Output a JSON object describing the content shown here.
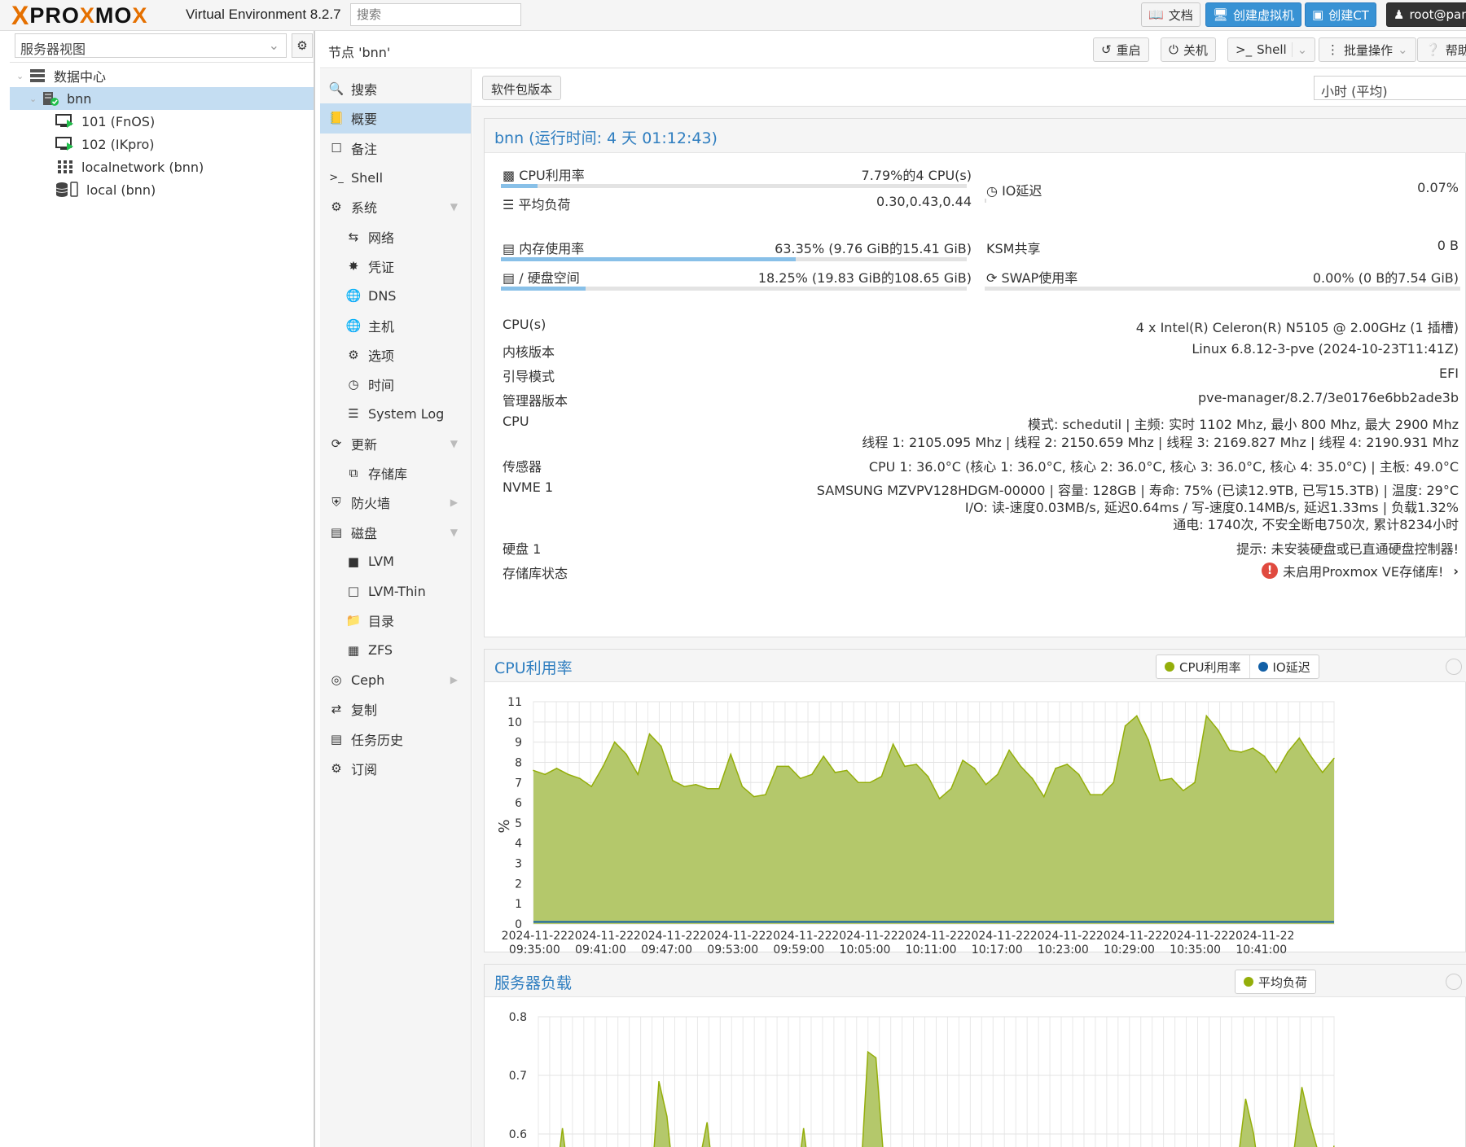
{
  "topbar": {
    "logo_x": "X",
    "logo_text_a": "PRO",
    "logo_text_x": "X",
    "logo_text_b": "MO",
    "logo_text_x2": "X",
    "version": "Virtual Environment 8.2.7",
    "search_placeholder": "搜索",
    "docs": "文档",
    "create_vm": "创建虚拟机",
    "create_ct": "创建CT",
    "user": "root@pam"
  },
  "sidebar": {
    "view_select": "服务器视图",
    "tree": [
      {
        "label": "数据中心"
      },
      {
        "label": "bnn"
      },
      {
        "label": "101 (FnOS)"
      },
      {
        "label": "102 (IKpro)"
      },
      {
        "label": "localnetwork (bnn)"
      },
      {
        "label": "local (bnn)"
      }
    ]
  },
  "header": {
    "title": "节点 'bnn'",
    "reboot": "重启",
    "shutdown": "关机",
    "shell": "Shell",
    "bulk": "批量操作",
    "help": "帮助"
  },
  "nav": {
    "items": [
      {
        "label": "搜索"
      },
      {
        "label": "概要"
      },
      {
        "label": "备注"
      },
      {
        "label": "Shell"
      },
      {
        "label": "系统"
      },
      {
        "label": "网络"
      },
      {
        "label": "凭证"
      },
      {
        "label": "DNS"
      },
      {
        "label": "主机"
      },
      {
        "label": "选项"
      },
      {
        "label": "时间"
      },
      {
        "label": "System Log"
      },
      {
        "label": "更新"
      },
      {
        "label": "存储库"
      },
      {
        "label": "防火墙"
      },
      {
        "label": "磁盘"
      },
      {
        "label": "LVM"
      },
      {
        "label": "LVM-Thin"
      },
      {
        "label": "目录"
      },
      {
        "label": "ZFS"
      },
      {
        "label": "Ceph"
      },
      {
        "label": "复制"
      },
      {
        "label": "任务历史"
      },
      {
        "label": "订阅"
      }
    ]
  },
  "toolbar": {
    "pkg_versions": "软件包版本",
    "timeframe": "小时 (平均)"
  },
  "status": {
    "title": "bnn (运行时间: 4 天 01:12:43)",
    "cpu_label": "CPU利用率",
    "cpu_value": "7.79%的4 CPU(s)",
    "cpu_fraction": 0.0779,
    "io_label": "IO延迟",
    "io_value": "0.07%",
    "load_label": "平均负荷",
    "load_value": "0.30,0.43,0.44",
    "mem_label": "内存使用率",
    "mem_value": "63.35% (9.76 GiB的15.41 GiB)",
    "mem_fraction": 0.6335,
    "ksm_label": "KSM共享",
    "ksm_value": "0 B",
    "disk_label": "/ 硬盘空间",
    "disk_value": "18.25% (19.83 GiB的108.65 GiB)",
    "disk_fraction": 0.1825,
    "swap_label": "SWAP使用率",
    "swap_value": "0.00% (0 B的7.54 GiB)",
    "swap_fraction": 0.0
  },
  "info": {
    "cpus_label": "CPU(s)",
    "cpus_value": "4 x Intel(R) Celeron(R) N5105 @ 2.00GHz (1 插槽)",
    "kernel_label": "内核版本",
    "kernel_value": "Linux 6.8.12-3-pve (2024-10-23T11:41Z)",
    "boot_label": "引导模式",
    "boot_value": "EFI",
    "manager_label": "管理器版本",
    "manager_value": "pve-manager/8.2.7/3e0176e6bb2ade3b",
    "cpu_label": "CPU",
    "cpu_line1": "模式: schedutil | 主频: 实时 1102 Mhz, 最小 800 Mhz, 最大 2900 Mhz",
    "cpu_line2": "线程 1: 2105.095 Mhz | 线程 2: 2150.659 Mhz | 线程 3: 2169.827 Mhz | 线程 4: 2190.931 Mhz",
    "sensor_label": "传感器",
    "sensor_value": "CPU 1: 36.0°C (核心 1: 36.0°C, 核心 2: 36.0°C, 核心 3: 36.0°C, 核心 4: 35.0°C) | 主板: 49.0°C",
    "nvme_label": "NVME 1",
    "nvme_line1": "SAMSUNG MZVPV128HDGM-00000 | 容量: 128GB | 寿命: 75% (已读12.9TB, 已写15.3TB) | 温度: 29°C",
    "nvme_line2": "I/O: 读-速度0.03MB/s, 延迟0.64ms / 写-速度0.14MB/s, 延迟1.33ms | 负载1.32%",
    "nvme_line3": "通电: 1740次, 不安全断电750次, 累计8234小时",
    "hdd_label": "硬盘 1",
    "hdd_value": "提示: 未安装硬盘或已直通硬盘控制器!",
    "repo_label": "存储库状态",
    "repo_value": "未启用Proxmox VE存储库!"
  },
  "cpu_chart": {
    "title": "CPU利用率",
    "legend_cpu": "CPU利用率",
    "legend_io": "IO延迟",
    "ylabel": "%"
  },
  "load_chart": {
    "title": "服务器负载",
    "legend_load": "平均负荷"
  },
  "chart_data": [
    {
      "type": "area",
      "title": "CPU利用率",
      "ylabel": "%",
      "ylim": [
        0,
        11
      ],
      "yticks": [
        "0",
        "1",
        "2",
        "3",
        "4",
        "5",
        "6",
        "7",
        "8",
        "9",
        "10",
        "11"
      ],
      "xtick_dates": [
        "2024-11-22",
        "2024-11-22",
        "2024-11-22",
        "2024-11-22",
        "2024-11-22",
        "2024-11-22",
        "2024-11-22",
        "2024-11-22",
        "2024-11-22",
        "2024-11-22",
        "2024-11-22",
        "2024-11-22"
      ],
      "xtick_times": [
        "09:35:00",
        "09:41:00",
        "09:47:00",
        "09:53:00",
        "09:59:00",
        "10:05:00",
        "10:11:00",
        "10:17:00",
        "10:23:00",
        "10:29:00",
        "10:35:00",
        "10:41:00"
      ],
      "x_start_min": -0.1,
      "x_end_min": 72.6,
      "series": [
        {
          "name": "CPU利用率",
          "color": "#94ae0a",
          "values": [
            7.6,
            7.4,
            7.7,
            7.4,
            7.2,
            6.8,
            7.8,
            9.0,
            8.4,
            7.4,
            9.4,
            8.8,
            7.1,
            6.8,
            6.9,
            6.7,
            6.7,
            8.4,
            6.8,
            6.3,
            6.4,
            7.8,
            7.8,
            7.2,
            7.4,
            8.3,
            7.5,
            7.6,
            7.0,
            7.0,
            7.3,
            8.9,
            7.8,
            7.9,
            7.3,
            6.2,
            6.7,
            8.1,
            7.7,
            6.9,
            7.4,
            8.6,
            7.8,
            7.2,
            6.3,
            7.7,
            7.9,
            7.4,
            6.4,
            6.4,
            7.0,
            9.8,
            10.3,
            9.1,
            7.1,
            7.2,
            6.6,
            7.0,
            10.3,
            9.6,
            8.6,
            8.5,
            8.7,
            8.3,
            7.5,
            8.5,
            9.2,
            8.3,
            7.5,
            8.2
          ]
        },
        {
          "name": "IO延迟",
          "color": "#115fa6",
          "values": [
            0.1,
            0.1,
            0.1,
            0.1,
            0.1,
            0.1,
            0.1,
            0.1,
            0.1,
            0.1,
            0.1,
            0.1,
            0.1,
            0.1,
            0.1,
            0.1,
            0.1,
            0.1,
            0.1,
            0.1,
            0.1,
            0.1,
            0.1,
            0.1,
            0.1,
            0.1,
            0.1,
            0.1,
            0.1,
            0.1,
            0.1,
            0.1,
            0.1,
            0.1,
            0.1,
            0.1,
            0.1,
            0.1,
            0.1,
            0.1,
            0.1,
            0.1,
            0.1,
            0.1,
            0.1,
            0.1,
            0.1,
            0.1,
            0.1,
            0.1,
            0.1,
            0.1,
            0.1,
            0.1,
            0.1,
            0.1,
            0.1,
            0.1,
            0.1,
            0.1,
            0.1,
            0.1,
            0.1,
            0.1,
            0.1,
            0.1,
            0.1,
            0.1,
            0.1,
            0.1
          ]
        }
      ]
    },
    {
      "type": "area",
      "title": "服务器负载",
      "ylim": [
        0.5,
        0.8
      ],
      "yticks": [
        "0.8",
        "0.7",
        "0.6"
      ],
      "series": [
        {
          "name": "平均负荷",
          "color": "#94ae0a",
          "values": [
            0.5,
            0.5,
            0.5,
            0.61,
            0.5,
            0.5,
            0.5,
            0.5,
            0.5,
            0.5,
            0.5,
            0.5,
            0.5,
            0.5,
            0.5,
            0.69,
            0.63,
            0.5,
            0.5,
            0.5,
            0.55,
            0.62,
            0.5,
            0.5,
            0.5,
            0.5,
            0.5,
            0.5,
            0.5,
            0.5,
            0.5,
            0.5,
            0.5,
            0.61,
            0.5,
            0.5,
            0.5,
            0.5,
            0.5,
            0.5,
            0.5,
            0.74,
            0.73,
            0.55,
            0.5,
            0.5,
            0.5,
            0.5,
            0.5,
            0.5,
            0.5,
            0.5,
            0.5,
            0.5,
            0.5,
            0.5,
            0.5,
            0.5,
            0.5,
            0.5,
            0.5,
            0.5,
            0.5,
            0.5,
            0.5,
            0.5,
            0.5,
            0.5,
            0.5,
            0.5,
            0.5,
            0.5,
            0.5,
            0.5,
            0.5,
            0.5,
            0.5,
            0.5,
            0.5,
            0.5,
            0.5,
            0.5,
            0.5,
            0.5,
            0.5,
            0.5,
            0.5,
            0.55,
            0.66,
            0.6,
            0.5,
            0.5,
            0.5,
            0.5,
            0.57,
            0.68,
            0.62,
            0.57,
            0.5,
            0.58
          ]
        }
      ]
    }
  ],
  "colors": {
    "accent": "#2f7ec0",
    "selection": "#c4ddf2",
    "brand_orange": "#e57000",
    "area_green": "#94ae0a",
    "io_blue": "#115fa6",
    "error_red": "#e04a3f"
  }
}
